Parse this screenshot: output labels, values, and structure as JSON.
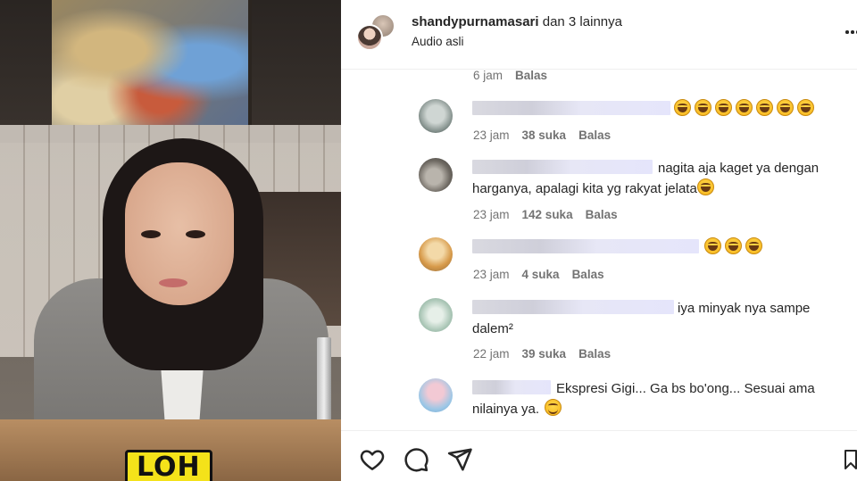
{
  "video": {
    "caption": "LOH"
  },
  "header": {
    "username": "shandypurnamasari",
    "others": " dan 3 lainnya",
    "audio": "Audio asli"
  },
  "comments": [
    {
      "meta_only": true,
      "time": "6 jam",
      "reply": "Balas"
    },
    {
      "text": "",
      "emoji_count": 7,
      "time": "23 jam",
      "likes": "38 suka",
      "reply": "Balas"
    },
    {
      "text_line1": "nagita aja kaget ya dengan",
      "text_line2": "harganya, apalagi kita yg rakyat jelata",
      "time": "23 jam",
      "likes": "142 suka",
      "reply": "Balas"
    },
    {
      "text": "",
      "emoji_count": 3,
      "time": "23 jam",
      "likes": "4 suka",
      "reply": "Balas"
    },
    {
      "text_line1": "iya minyak nya sampe",
      "text_line2": "dalem²",
      "time": "22 jam",
      "likes": "39 suka",
      "reply": "Balas"
    },
    {
      "text_line1": "Ekspresi Gigi... Ga bs bo'ong... Sesuai ama",
      "text_line2": "nilainya ya.",
      "time": "",
      "likes": "",
      "reply": ""
    }
  ],
  "icons": [
    "heart-icon",
    "comment-icon",
    "share-icon",
    "bookmark-icon",
    "more-icon"
  ],
  "colors": {
    "caption_bg": "#f4e21a",
    "meta_text": "#737373",
    "primary_text": "#262626"
  }
}
